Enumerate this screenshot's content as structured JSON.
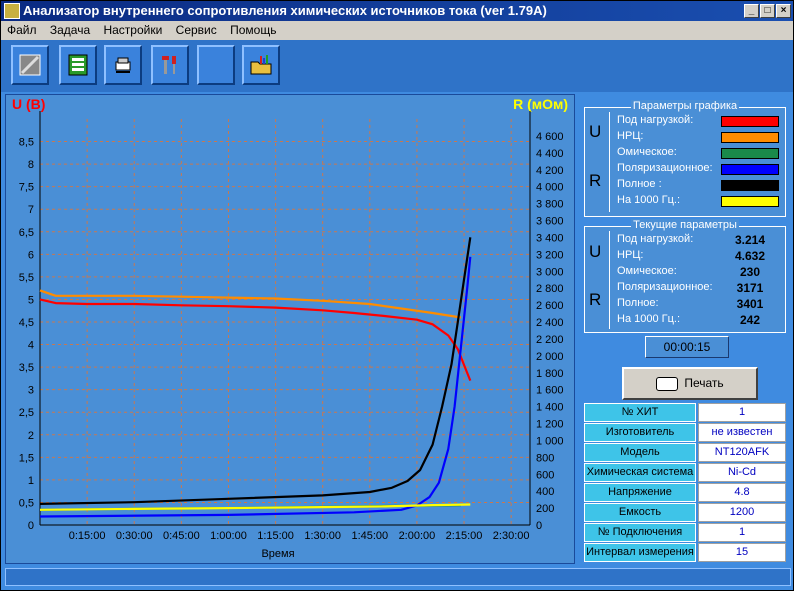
{
  "window": {
    "title": "Анализатор внутреннего сопротивления химических источников тока (ver 1.79A)"
  },
  "menu": [
    "Файл",
    "Задача",
    "Настройки",
    "Сервис",
    "Помощь"
  ],
  "toolbar": {
    "buttons": [
      "disk-icon",
      "chip-board-icon",
      "settings-icon",
      "tools-icon",
      "blank-icon",
      "folder-chart-icon"
    ]
  },
  "chart_data": {
    "type": "line",
    "left_axis_label": "U (В)",
    "right_axis_label": "R (мОм)",
    "xlabel": "Время",
    "x_ticks": [
      "0:15:00",
      "0:30:00",
      "0:45:00",
      "1:00:00",
      "1:15:00",
      "1:30:00",
      "1:45:00",
      "2:00:00",
      "2:15:00",
      "2:30:00"
    ],
    "xlim_minutes": [
      0,
      156
    ],
    "left_ylim": [
      0,
      9
    ],
    "left_ticks": [
      "0",
      "0,5",
      "1",
      "1,5",
      "2",
      "2,5",
      "3",
      "3,5",
      "4",
      "4,5",
      "5",
      "5,5",
      "6",
      "6,5",
      "7",
      "7,5",
      "8",
      "8,5"
    ],
    "right_ylim": [
      0,
      4800
    ],
    "right_ticks": [
      "0",
      "200",
      "400",
      "600",
      "800",
      "1 000",
      "1 200",
      "1 400",
      "1 600",
      "1 800",
      "2 000",
      "2 200",
      "2 400",
      "2 600",
      "2 800",
      "3 000",
      "3 200",
      "3 400",
      "3 600",
      "3 800",
      "4 000",
      "4 200",
      "4 400",
      "4 600"
    ],
    "grid": true,
    "series": [
      {
        "name": "Под нагрузкой",
        "axis": "left",
        "color": "#ff0000",
        "points": [
          [
            0,
            5.0
          ],
          [
            5,
            4.92
          ],
          [
            15,
            4.9
          ],
          [
            30,
            4.9
          ],
          [
            45,
            4.87
          ],
          [
            60,
            4.85
          ],
          [
            75,
            4.82
          ],
          [
            90,
            4.76
          ],
          [
            100,
            4.7
          ],
          [
            110,
            4.63
          ],
          [
            120,
            4.55
          ],
          [
            125,
            4.45
          ],
          [
            130,
            4.2
          ],
          [
            133,
            3.9
          ],
          [
            135,
            3.55
          ],
          [
            137,
            3.2
          ]
        ]
      },
      {
        "name": "НРЦ",
        "axis": "left",
        "color": "#ff8c00",
        "points": [
          [
            0,
            5.2
          ],
          [
            5,
            5.08
          ],
          [
            15,
            5.08
          ],
          [
            30,
            5.08
          ],
          [
            45,
            5.06
          ],
          [
            60,
            5.04
          ],
          [
            75,
            5.02
          ],
          [
            90,
            4.97
          ],
          [
            105,
            4.9
          ],
          [
            115,
            4.8
          ],
          [
            125,
            4.7
          ],
          [
            134,
            4.6
          ]
        ]
      },
      {
        "name": "Омическое",
        "axis": "right",
        "color": "#1a8a4a",
        "points": [
          [
            0,
            180
          ],
          [
            30,
            190
          ],
          [
            60,
            200
          ],
          [
            90,
            215
          ],
          [
            110,
            225
          ],
          [
            125,
            230
          ],
          [
            134,
            235
          ]
        ]
      },
      {
        "name": "Поляризационное",
        "axis": "right",
        "color": "#0000ff",
        "points": [
          [
            0,
            100
          ],
          [
            60,
            120
          ],
          [
            100,
            150
          ],
          [
            115,
            180
          ],
          [
            120,
            230
          ],
          [
            124,
            330
          ],
          [
            127,
            500
          ],
          [
            130,
            900
          ],
          [
            132,
            1400
          ],
          [
            134,
            2100
          ],
          [
            136,
            2800
          ],
          [
            137,
            3171
          ]
        ]
      },
      {
        "name": "Полное",
        "axis": "right",
        "color": "#000000",
        "points": [
          [
            0,
            250
          ],
          [
            30,
            270
          ],
          [
            60,
            310
          ],
          [
            90,
            350
          ],
          [
            105,
            390
          ],
          [
            112,
            440
          ],
          [
            117,
            520
          ],
          [
            121,
            650
          ],
          [
            125,
            950
          ],
          [
            128,
            1400
          ],
          [
            131,
            1900
          ],
          [
            133,
            2400
          ],
          [
            135,
            2900
          ],
          [
            137,
            3401
          ]
        ]
      },
      {
        "name": "На 1000 Гц.",
        "axis": "right",
        "color": "#ffff00",
        "points": [
          [
            0,
            180
          ],
          [
            30,
            190
          ],
          [
            60,
            200
          ],
          [
            90,
            212
          ],
          [
            110,
            220
          ],
          [
            125,
            235
          ],
          [
            137,
            242
          ]
        ]
      }
    ]
  },
  "graph_params": {
    "title": "Параметры графика",
    "rows": [
      {
        "label": "Под нагрузкой:",
        "color": "#ff0000"
      },
      {
        "label": "НРЦ:",
        "color": "#ff8c00"
      },
      {
        "label": "Омическое:",
        "color": "#1a8a4a"
      },
      {
        "label": "Поляризационное:",
        "color": "#0000ff"
      },
      {
        "label": "Полное :",
        "color": "#000000"
      },
      {
        "label": "На 1000 Гц.:",
        "color": "#ffff00"
      }
    ]
  },
  "current_params": {
    "title": "Текущие параметры",
    "rows": [
      {
        "label": "Под нагрузкой:",
        "value": "3.214"
      },
      {
        "label": "НРЦ:",
        "value": "4.632"
      },
      {
        "label": "Омическое:",
        "value": "230"
      },
      {
        "label": "Поляризационное:",
        "value": "3171"
      },
      {
        "label": "Полное:",
        "value": "3401"
      },
      {
        "label": "На 1000 Гц.:",
        "value": "242"
      }
    ]
  },
  "group_letters": {
    "u": "U",
    "r": "R"
  },
  "timer": "00:00:15",
  "print_label": "Печать",
  "info": [
    {
      "label": "№ ХИТ",
      "value": "1"
    },
    {
      "label": "Изготовитель",
      "value": "не известен"
    },
    {
      "label": "Модель",
      "value": "NT120AFK"
    },
    {
      "label": "Химическая система",
      "value": "Ni-Cd"
    },
    {
      "label": "Напряжение",
      "value": "4.8"
    },
    {
      "label": "Емкость",
      "value": "1200"
    },
    {
      "label": "№ Подключения",
      "value": "1"
    },
    {
      "label": "Интервал измерения",
      "value": "15"
    }
  ]
}
